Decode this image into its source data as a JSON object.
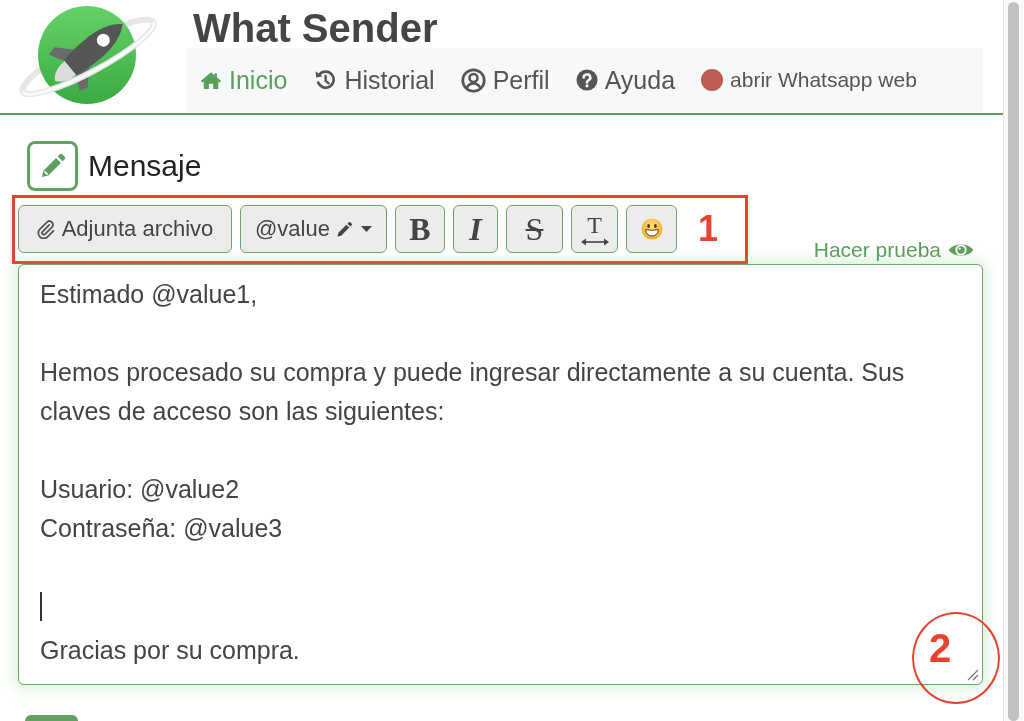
{
  "header": {
    "title": "What Sender"
  },
  "nav": {
    "items": [
      {
        "kind": "link",
        "label": "Inicio",
        "selected": true
      },
      {
        "kind": "link",
        "label": "Historial",
        "selected": false
      },
      {
        "kind": "link",
        "label": "Perfil",
        "selected": false
      },
      {
        "kind": "link",
        "label": "Ayuda",
        "selected": false
      },
      {
        "kind": "status",
        "label": "abrir Whatsapp web",
        "selected": false,
        "color": "#bd5a52"
      }
    ]
  },
  "section": {
    "title": "Mensaje"
  },
  "toolbar": {
    "buttons": [
      {
        "kind": "attach",
        "label": "Adjunta archivo"
      },
      {
        "kind": "dropdown",
        "label": "@value"
      },
      {
        "kind": "bold",
        "label": "B"
      },
      {
        "kind": "italic",
        "label": "I"
      },
      {
        "kind": "strike",
        "label": "S"
      },
      {
        "kind": "textwidth",
        "label": "T"
      },
      {
        "kind": "emoji"
      }
    ]
  },
  "preview_link": {
    "label": "Hacer prueba"
  },
  "editor": {
    "lines": [
      {
        "kind": "text",
        "text": "Estimado @value1,"
      },
      {
        "kind": "blank"
      },
      {
        "kind": "text",
        "text": "Hemos procesado su compra y puede ingresar directamente a su cuenta. Sus claves de acceso son las siguientes:"
      },
      {
        "kind": "blank"
      },
      {
        "kind": "text",
        "text": "Usuario: @value2"
      },
      {
        "kind": "text",
        "text": "Contraseña: @value3"
      },
      {
        "kind": "blank"
      },
      {
        "kind": "caret"
      },
      {
        "kind": "text",
        "text": "Gracias por su compra."
      }
    ]
  },
  "annotations": [
    {
      "kind": "box",
      "label": "1"
    },
    {
      "kind": "circle",
      "label": "2"
    }
  ]
}
